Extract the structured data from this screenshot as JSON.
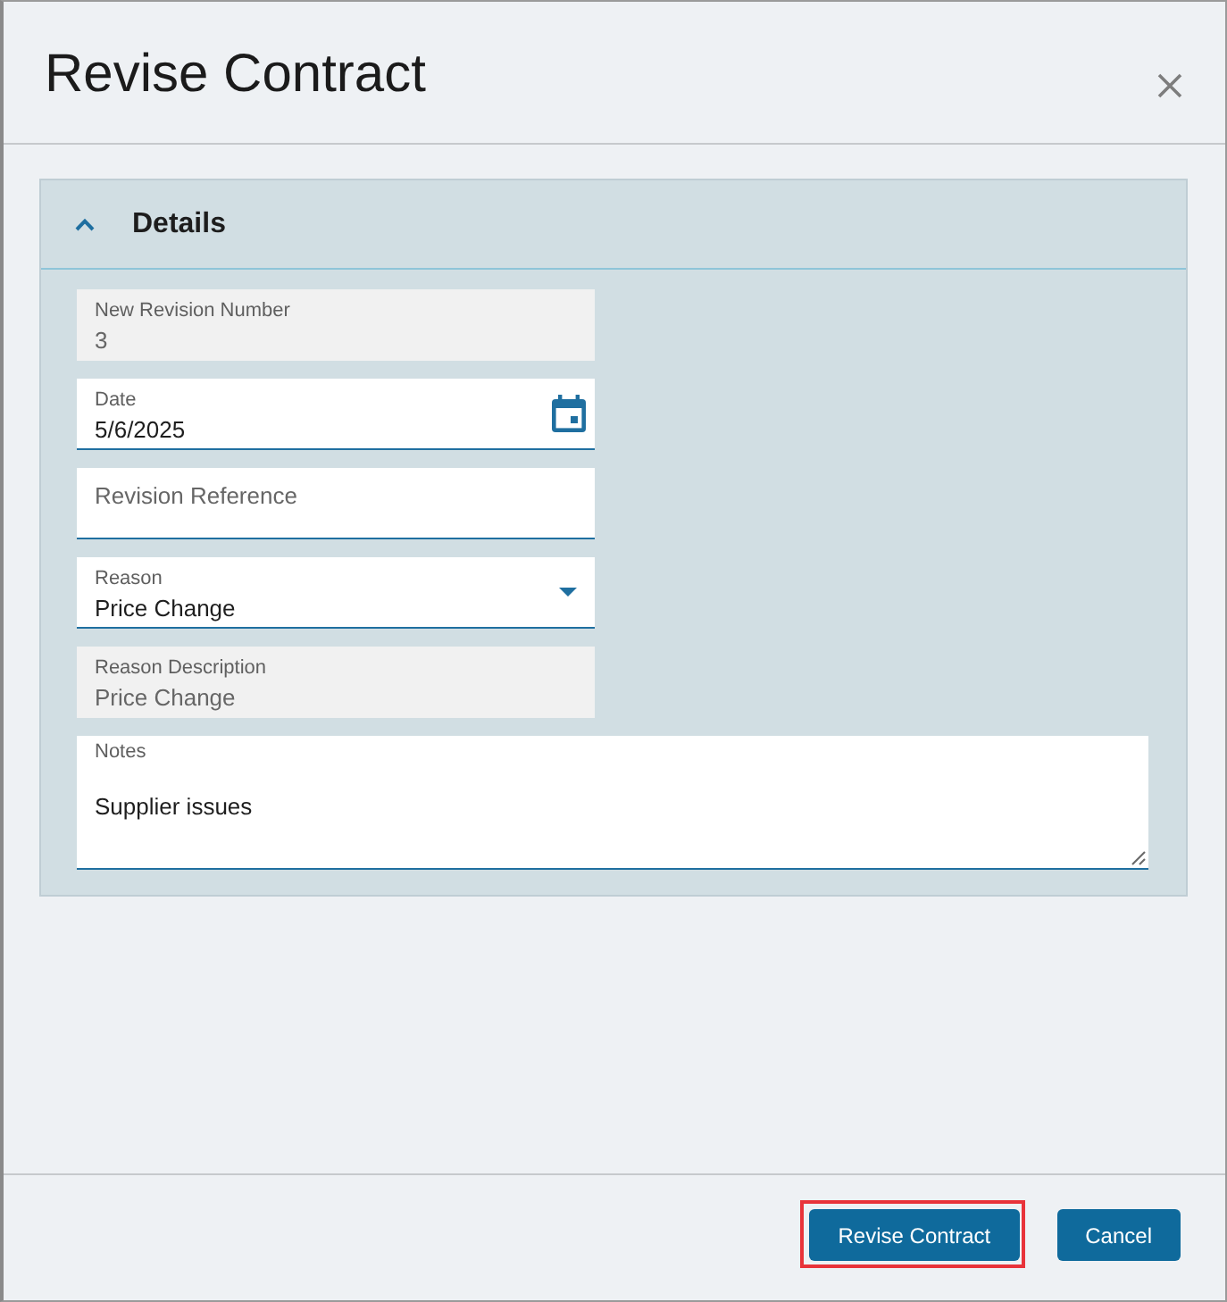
{
  "dialog": {
    "title": "Revise Contract"
  },
  "section": {
    "title": "Details",
    "expanded": true,
    "fields": [
      {
        "kind": "readonly",
        "label": "New Revision Number",
        "value": "3"
      },
      {
        "kind": "date",
        "label": "Date",
        "value": "5/6/2025"
      },
      {
        "kind": "text",
        "placeholder": "Revision Reference"
      },
      {
        "kind": "select",
        "label": "Reason",
        "value": "Price Change"
      },
      {
        "kind": "readonly",
        "label": "Reason Description",
        "value": "Price Change"
      },
      {
        "kind": "textarea",
        "label": "Notes",
        "value": "Supplier issues"
      }
    ]
  },
  "buttons": [
    {
      "label": "Revise Contract",
      "highlighted": true
    },
    {
      "label": "Cancel",
      "highlighted": false
    }
  ]
}
